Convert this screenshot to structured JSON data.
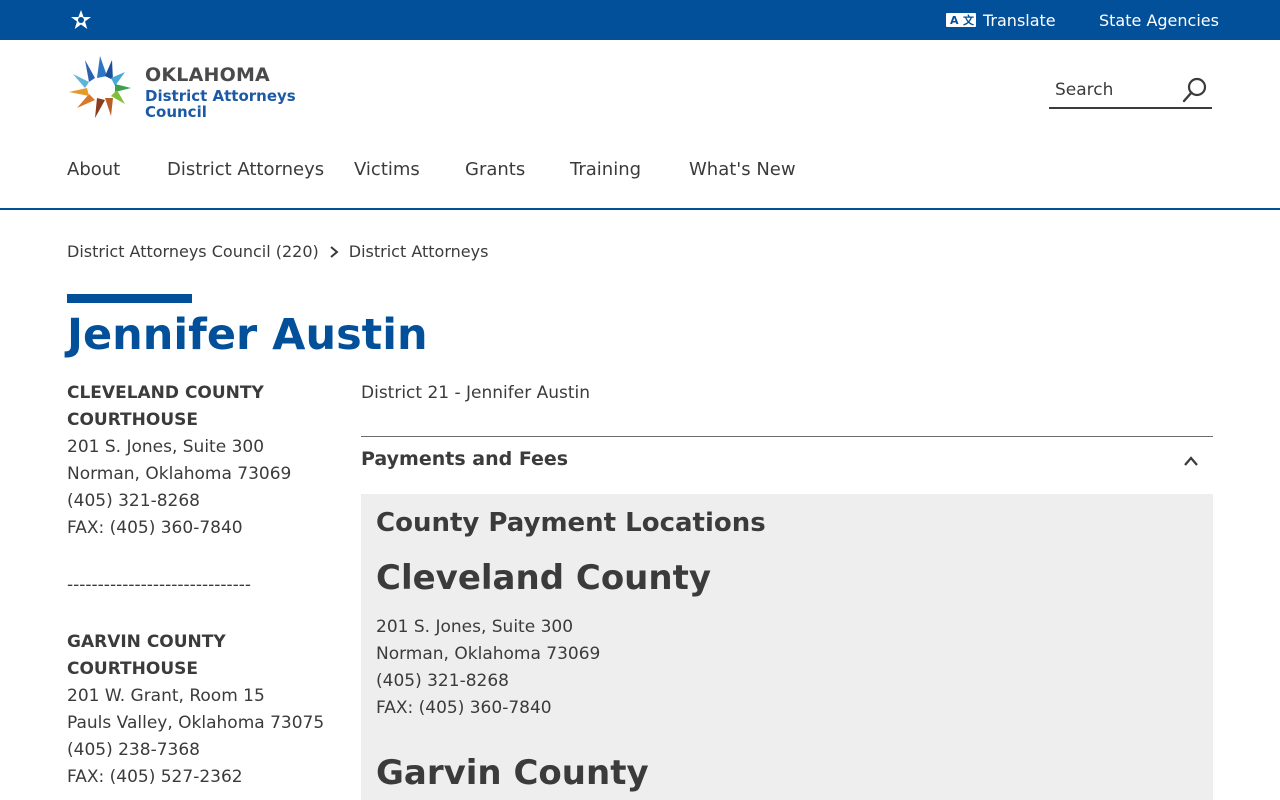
{
  "topbar": {
    "translate_label": "Translate",
    "agencies_label": "State Agencies",
    "colors": {
      "bar": "#02509a"
    }
  },
  "logo": {
    "line1": "OKLAHOMA",
    "line2": "District Attorneys",
    "line3": "Council"
  },
  "search": {
    "placeholder": "Search"
  },
  "nav": {
    "items": [
      "About",
      "District Attorneys",
      "Victims",
      "Grants",
      "Training",
      "What's New"
    ]
  },
  "breadcrumb": {
    "items": [
      "District Attorneys Council (220)",
      "District Attorneys"
    ]
  },
  "page": {
    "title": "Jennifer Austin",
    "subtitle": "District 21 - Jennifer Austin"
  },
  "sidebar": {
    "offices": [
      {
        "head1": "CLEVELAND COUNTY",
        "head2": "COURTHOUSE",
        "address": "201 S. Jones, Suite 300",
        "city": "Norman, Oklahoma 73069",
        "phone": "(405) 321-8268",
        "fax": "FAX: (405) 360-7840"
      },
      {
        "head1": "GARVIN COUNTY",
        "head2": "COURTHOUSE",
        "address": "201 W. Grant, Room 15",
        "city": "Pauls Valley, Oklahoma 73075",
        "phone": "(405) 238-7368",
        "fax": "FAX: (405) 527-2362"
      }
    ],
    "divider": "------------------------------"
  },
  "accordion": {
    "label": "Payments and Fees",
    "expanded": true,
    "panel": {
      "title": "County Payment Locations",
      "counties": [
        {
          "name": "Cleveland County",
          "address": "201 S. Jones, Suite 300",
          "city": "Norman, Oklahoma 73069",
          "phone": "(405) 321-8268",
          "fax": "FAX: (405) 360-7840"
        },
        {
          "name": "Garvin County"
        }
      ]
    }
  },
  "icons": [
    "star-icon",
    "translate-icon",
    "search-icon",
    "chevron-right-icon",
    "chevron-up-icon"
  ]
}
